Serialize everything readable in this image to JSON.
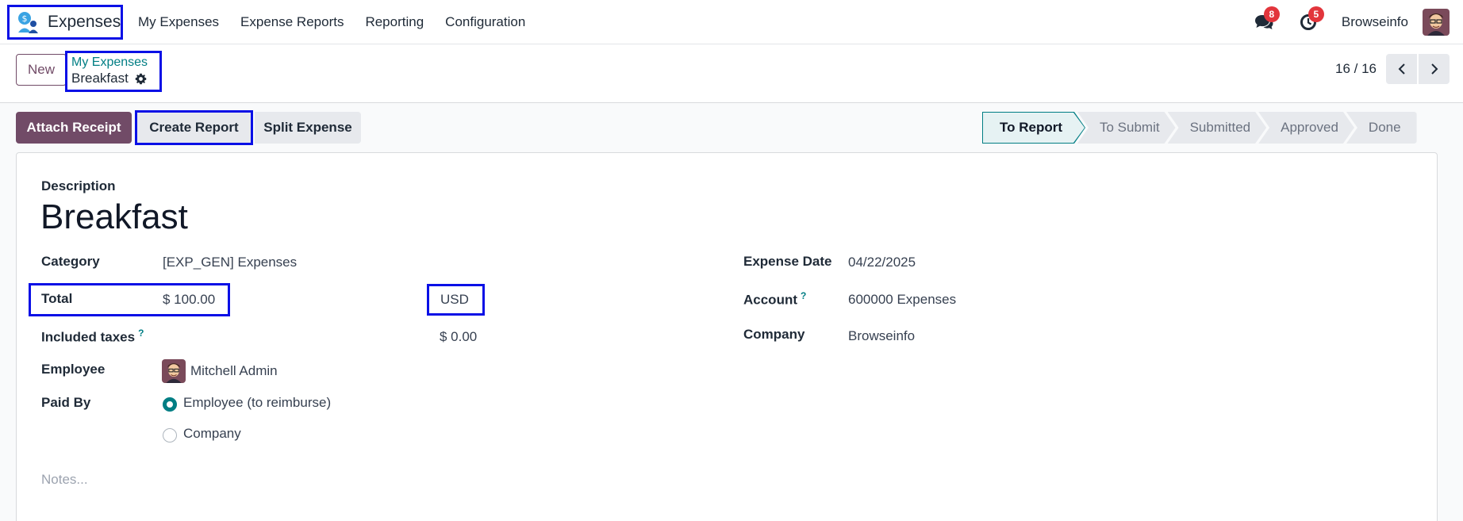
{
  "navbar": {
    "app_name": "Expenses",
    "menu": [
      "My Expenses",
      "Expense Reports",
      "Reporting",
      "Configuration"
    ],
    "messages_count": "8",
    "activities_count": "5",
    "company": "Browseinfo"
  },
  "control_panel": {
    "new_label": "New",
    "breadcrumb_parent": "My Expenses",
    "breadcrumb_current": "Breakfast",
    "pager": "16 / 16"
  },
  "actions": {
    "attach_receipt": "Attach Receipt",
    "create_report": "Create Report",
    "split_expense": "Split Expense"
  },
  "status_stages": [
    "To Report",
    "To Submit",
    "Submitted",
    "Approved",
    "Done"
  ],
  "active_stage": "To Report",
  "form": {
    "description_label": "Description",
    "description": "Breakfast",
    "category_label": "Category",
    "category": "[EXP_GEN] Expenses",
    "total_label": "Total",
    "total": "$ 100.00",
    "currency": "USD",
    "included_taxes_label": "Included taxes",
    "help_mark": "?",
    "included_taxes": "$ 0.00",
    "employee_label": "Employee",
    "employee": "Mitchell Admin",
    "paid_by_label": "Paid By",
    "paid_by_options": [
      "Employee (to reimburse)",
      "Company"
    ],
    "paid_by_selected": "Employee (to reimburse)",
    "expense_date_label": "Expense Date",
    "expense_date": "04/22/2025",
    "account_label": "Account",
    "account": "600000 Expenses",
    "company_label": "Company",
    "company": "Browseinfo",
    "notes_placeholder": "Notes..."
  },
  "colors": {
    "brand": "#714b67",
    "accent": "#017e84",
    "highlight_box": "#0a10e6",
    "badge": "#e2353c"
  }
}
